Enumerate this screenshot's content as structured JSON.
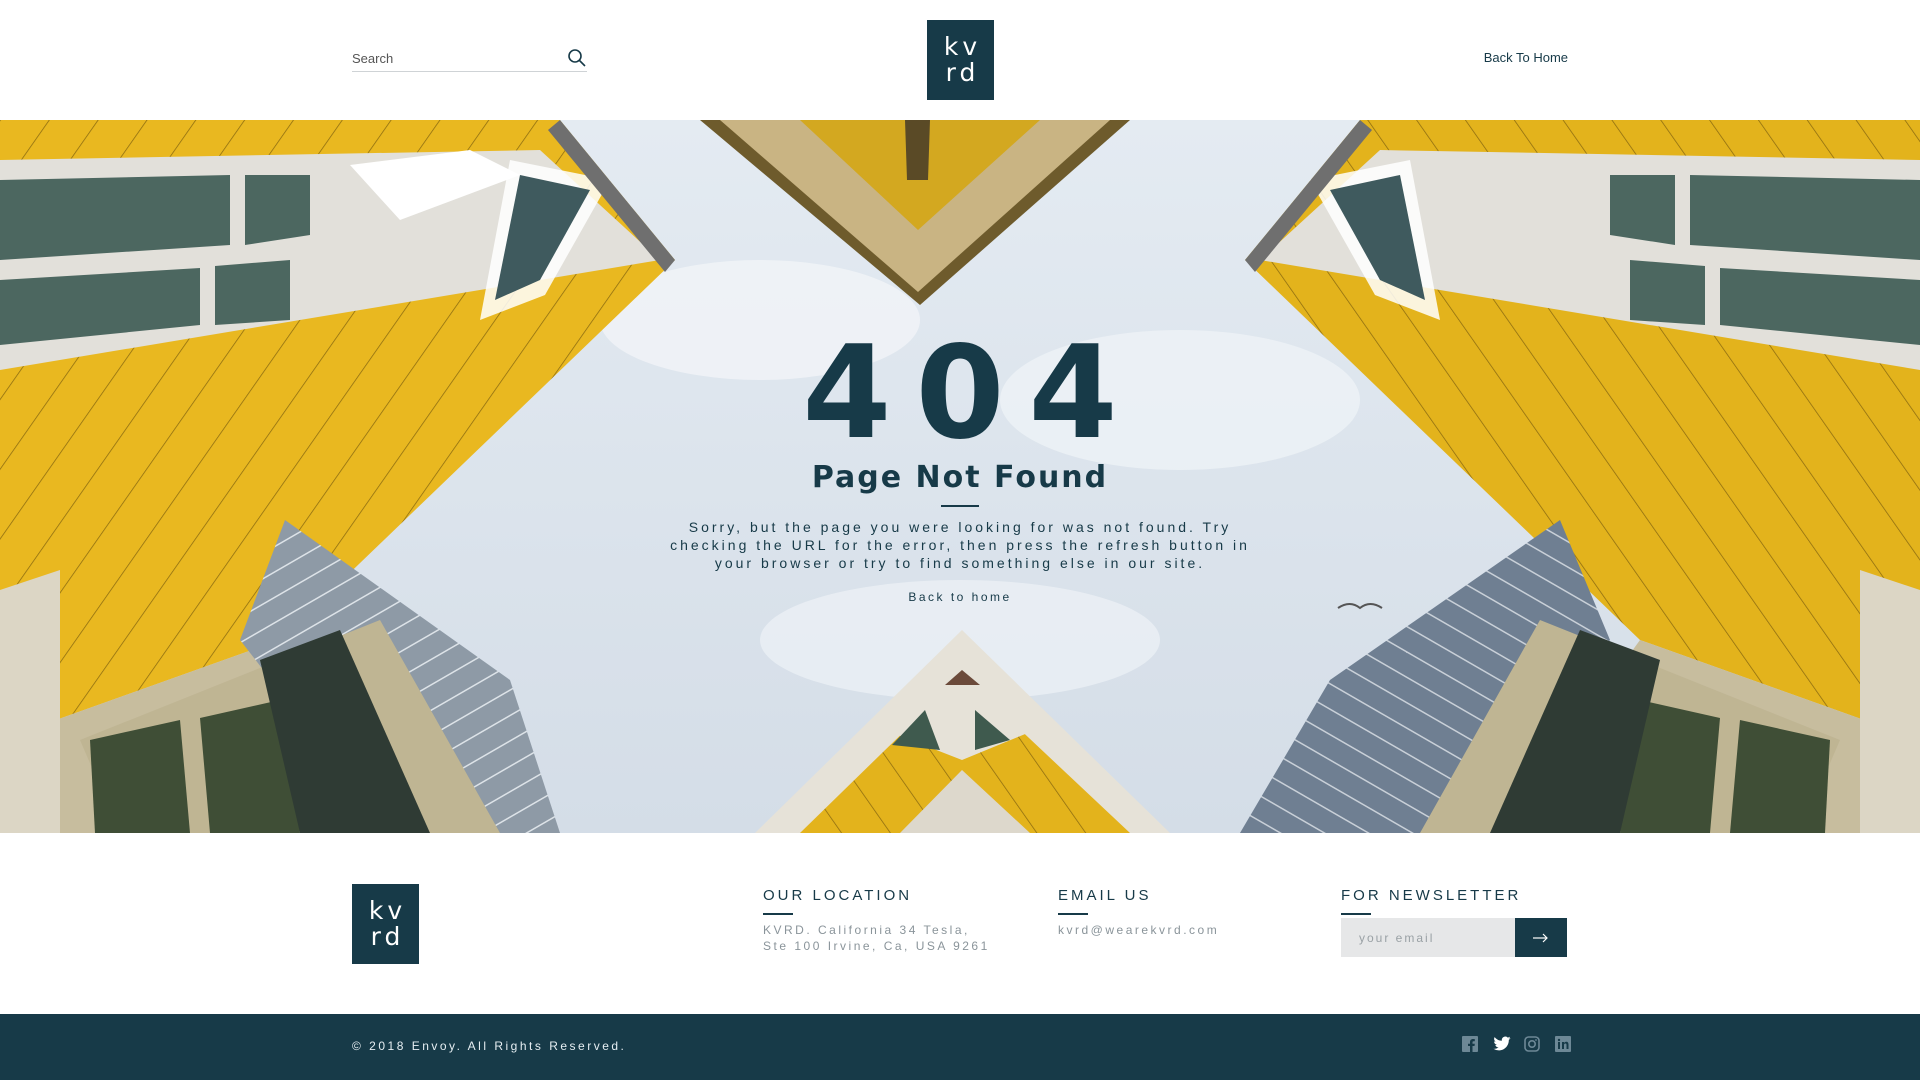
{
  "header": {
    "search_placeholder": "Search",
    "logo_top": "kv",
    "logo_bottom": "rd",
    "back_link": "Back To Home"
  },
  "hero": {
    "error_code": "404",
    "title": "Page Not Found",
    "message": "Sorry, but the page you were looking for was not found. Try checking the URL for the error, then press the refresh button in your browser or try to find something else in our site.",
    "back_link": "Back to home"
  },
  "footer": {
    "logo_top": "kv",
    "logo_bottom": "rd",
    "location": {
      "heading": "OUR LOCATION",
      "line1": "KVRD. California 34 Tesla,",
      "line2": "Ste 100 Irvine, Ca, USA 9261"
    },
    "email": {
      "heading": "EMAIL US",
      "address": "kvrd@wearekvrd.com"
    },
    "newsletter": {
      "heading": "FOR NEWSLETTER",
      "placeholder": "your email",
      "submit_icon": "arrow-right-icon"
    }
  },
  "bottom_bar": {
    "copyright": "© 2018 Envoy. All Rights Reserved.",
    "social_icons": [
      "facebook-icon",
      "twitter-icon",
      "instagram-icon",
      "linkedin-icon"
    ]
  },
  "colors": {
    "brand_dark": "#173a48",
    "cube_yellow": "#e9b820",
    "sky": "#dfe6ee"
  }
}
